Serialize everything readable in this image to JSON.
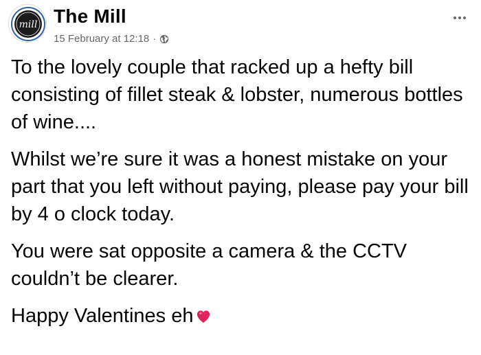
{
  "page": {
    "name": "The Mill",
    "logo_text": "mill"
  },
  "post": {
    "timestamp": "15 February at 12:18",
    "separator": "·",
    "audience_icon": "globe-icon",
    "paragraphs": [
      "To the lovely couple that racked up a hefty bill consisting of fillet steak & lobster, numerous bottles of wine....",
      "Whilst we’re sure it was a honest mistake on your part that you left without paying, please pay your bill by 4 o clock today.",
      "You were sat opposite a camera & the CCTV couldn’t be clearer."
    ],
    "closing": "Happy Valentines eh",
    "closing_emoji": "heart-icon"
  },
  "colors": {
    "text": "#050505",
    "secondary": "#65676b",
    "heart": "#e0245e",
    "logo_bg": "#1b1b1b",
    "logo_ring": "#2d5fa6"
  }
}
